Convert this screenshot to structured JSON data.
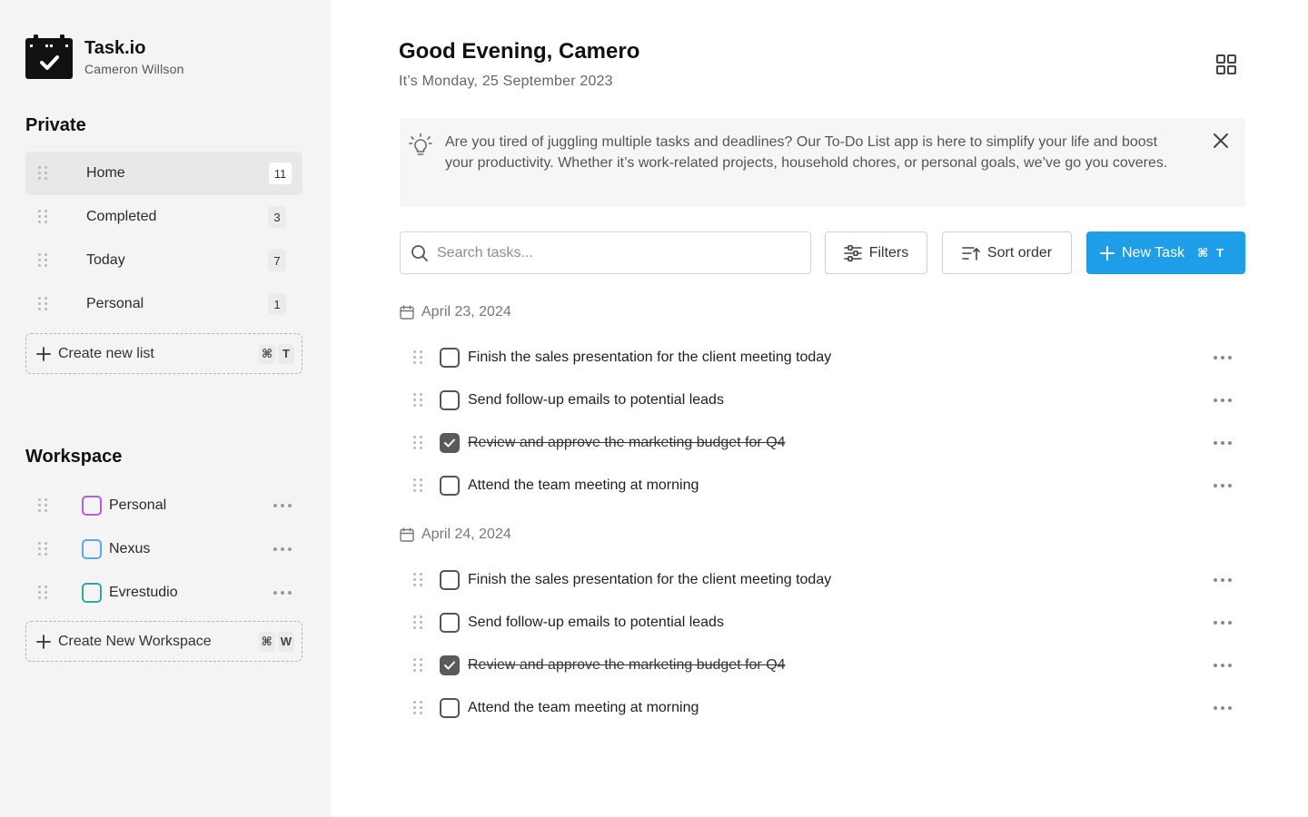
{
  "brand": {
    "name": "Task.io",
    "user": "Cameron Willson"
  },
  "private": {
    "title": "Private",
    "items": [
      {
        "label": "Home",
        "count": "11"
      },
      {
        "label": "Completed",
        "count": "3"
      },
      {
        "label": "Today",
        "count": "7"
      },
      {
        "label": "Personal",
        "count": "1"
      }
    ],
    "create_label": "Create new list",
    "create_kbd": [
      "⌘",
      "T"
    ]
  },
  "workspace": {
    "title": "Workspace",
    "items": [
      {
        "label": "Personal",
        "color": "#b45ee0"
      },
      {
        "label": "Nexus",
        "color": "#5aa9e6"
      },
      {
        "label": "Evrestudio",
        "color": "#2fa9a0"
      }
    ],
    "create_label": "Create New Workspace",
    "create_kbd": [
      "⌘",
      "W"
    ]
  },
  "header": {
    "greeting": "Good Evening, Camero",
    "date": "It’s Monday, 25 September 2023"
  },
  "banner": {
    "text": "Are you tired of juggling multiple tasks and deadlines? Our To-Do List app is here to simplify your life and boost your productivity. Whether it’s work-related projects, household chores, or personal goals, we’ve go you coveres."
  },
  "toolbar": {
    "search_placeholder": "Search tasks...",
    "filters_label": "Filters",
    "sort_label": "Sort order",
    "new_task_label": "New Task",
    "new_task_kbd": [
      "⌘",
      "T"
    ]
  },
  "colors": {
    "accent": "#1e9ee8",
    "sidebar_bg": "#f4f4f4",
    "active_item_bg": "#e8e8e8"
  },
  "task_groups": [
    {
      "date": "April 23, 2024",
      "tasks": [
        {
          "label": "Finish the sales presentation for the client meeting today",
          "done": false
        },
        {
          "label": "Send follow-up emails to potential leads",
          "done": false
        },
        {
          "label": "Review and approve the marketing budget for Q4",
          "done": true
        },
        {
          "label": "Attend the team meeting at morning",
          "done": false
        }
      ]
    },
    {
      "date": "April 24, 2024",
      "tasks": [
        {
          "label": "Finish the sales presentation for the client meeting today",
          "done": false
        },
        {
          "label": "Send follow-up emails to potential leads",
          "done": false
        },
        {
          "label": "Review and approve the marketing budget for Q4",
          "done": true
        },
        {
          "label": "Attend the team meeting at morning",
          "done": false
        }
      ]
    }
  ]
}
